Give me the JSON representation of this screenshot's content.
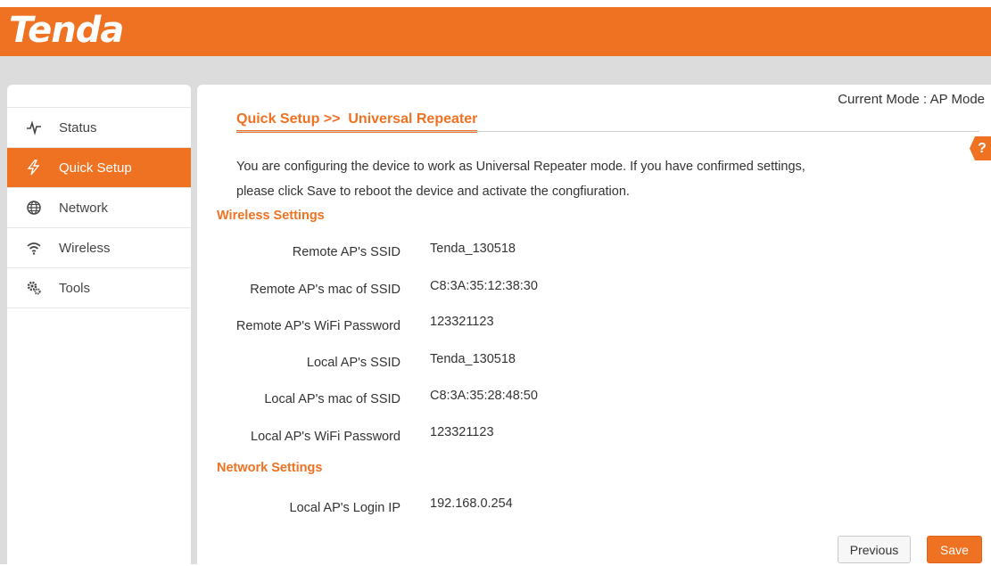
{
  "brand": {
    "logo_text": "Tenda",
    "accent_color": "#ef7122"
  },
  "header": {
    "current_mode": "Current Mode : AP Mode"
  },
  "sidebar": {
    "items": [
      {
        "label": "Status",
        "icon": "pulse-icon",
        "active": false
      },
      {
        "label": "Quick Setup",
        "icon": "lightning-icon",
        "active": true
      },
      {
        "label": "Network",
        "icon": "globe-icon",
        "active": false
      },
      {
        "label": "Wireless",
        "icon": "wifi-icon",
        "active": false
      },
      {
        "label": "Tools",
        "icon": "gears-icon",
        "active": false
      }
    ]
  },
  "main": {
    "breadcrumb": "Quick Setup >>  Universal Repeater",
    "help_label": "?",
    "description_line1": "You are configuring the device to work as Universal Repeater mode. If you have confirmed settings,",
    "description_line2": "please click Save to reboot the device and activate the congfiuration.",
    "wireless_section": {
      "title": "Wireless Settings",
      "rows": [
        {
          "label": "Remote AP's SSID",
          "value": "Tenda_130518"
        },
        {
          "label": "Remote AP's mac of SSID",
          "value": "C8:3A:35:12:38:30"
        },
        {
          "label": "Remote AP's WiFi Password",
          "value": "123321123"
        },
        {
          "label": "Local AP's SSID",
          "value": "Tenda_130518"
        },
        {
          "label": "Local AP's mac of SSID",
          "value": "C8:3A:35:28:48:50"
        },
        {
          "label": "Local AP's WiFi Password",
          "value": "123321123"
        }
      ]
    },
    "network_section": {
      "title": "Network Settings",
      "rows": [
        {
          "label": "Local AP's Login IP",
          "value": "192.168.0.254"
        }
      ]
    },
    "buttons": {
      "previous": "Previous",
      "save": "Save"
    }
  }
}
